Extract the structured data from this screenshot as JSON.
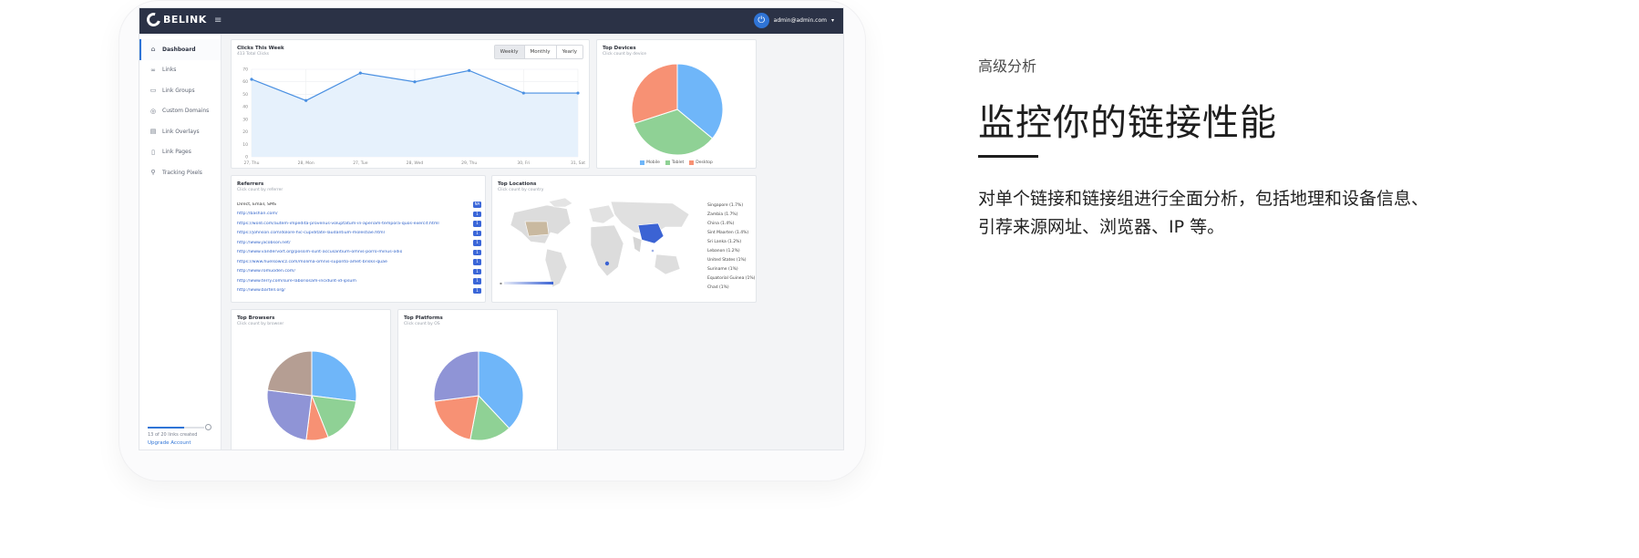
{
  "brand": {
    "logo_text": "BELINK",
    "menu_icon": "hamburger-icon"
  },
  "topbar": {
    "user_email": "admin@admin.com",
    "user_icon": "power-icon",
    "caret": "▾"
  },
  "sidebar": {
    "items": [
      {
        "label": "Dashboard",
        "icon": "home-icon",
        "active": true
      },
      {
        "label": "Links",
        "icon": "link-icon"
      },
      {
        "label": "Link Groups",
        "icon": "folder-icon"
      },
      {
        "label": "Custom Domains",
        "icon": "globe-icon"
      },
      {
        "label": "Link Overlays",
        "icon": "layers-icon"
      },
      {
        "label": "Link Pages",
        "icon": "page-icon"
      },
      {
        "label": "Tracking Pixels",
        "icon": "pin-icon"
      }
    ],
    "usage_text": "13 of 20 links created",
    "usage_fraction": 0.65,
    "upgrade_label": "Upgrade Account"
  },
  "clicks_card": {
    "title": "Clicks This Week",
    "subtitle": "413 Total Clicks",
    "range_buttons": [
      "Weekly",
      "Monthly",
      "Yearly"
    ],
    "selected_range": "Weekly",
    "chart_data": {
      "type": "area",
      "categories": [
        "27, Thu",
        "28, Mon",
        "27, Tue",
        "28, Wed",
        "29, Thu",
        "30, Fri",
        "31, Sat"
      ],
      "values": [
        62,
        45,
        67,
        60,
        69,
        51,
        51
      ],
      "ylim": [
        0,
        70
      ],
      "yticks": [
        0,
        10,
        20,
        30,
        40,
        50,
        60,
        70
      ],
      "line_color": "#4a90e2",
      "fill_color": "#e6f1fc"
    }
  },
  "devices_card": {
    "title": "Top Devices",
    "subtitle": "Click count by device",
    "chart_data": {
      "type": "pie",
      "labels": [
        "Mobile",
        "Tablet",
        "Desktop"
      ],
      "values": [
        36,
        34,
        30
      ],
      "colors": [
        "#6fb6f9",
        "#8fd195",
        "#f79174"
      ]
    }
  },
  "referrers_card": {
    "title": "Referrers",
    "subtitle": "Click count by referrer",
    "rows": [
      {
        "url": "Direct, Email, SMS",
        "count": "NA"
      },
      {
        "url": "http://bashan.com/",
        "count": "1"
      },
      {
        "url": "https://wold.com/autem-impedita-provenus-voluptatum-in-aperiam-tempora-quos-exercit.html",
        "count": "1"
      },
      {
        "url": "https://johnson.com/dolore-hic-cupiditate-laudantium-molestiae.html",
        "count": "1"
      },
      {
        "url": "http://www.jacobson.net/",
        "count": "1"
      },
      {
        "url": "http://www.vandervort.org/possim-sunt-accusantium-omnis-porro-minus-odio",
        "count": "1"
      },
      {
        "url": "https://www.huelsowicz.com/molima-omnis-suponto-amet-brisks-quae",
        "count": "1"
      },
      {
        "url": "http://www.romuoden.com/",
        "count": "1"
      },
      {
        "url": "http://www.terry.com/sure-laboriosam-incidunt-id-ipsum",
        "count": "1"
      },
      {
        "url": "http://www.bartell.org/",
        "count": "1"
      }
    ]
  },
  "locations_card": {
    "title": "Top Locations",
    "subtitle": "Click count by country",
    "countries": [
      "Singapore (1.7%)",
      "Zambia (1.7%)",
      "China (1.4%)",
      "Sint Maarten (1.4%)",
      "Sri Lanka (1.2%)",
      "Lebanon (1.2%)",
      "United States (1%)",
      "Suriname (1%)",
      "Equatorial Guinea (1%)",
      "Chad (1%)"
    ]
  },
  "browsers_card": {
    "title": "Top Browsers",
    "subtitle": "Click count by browser",
    "chart_data": {
      "type": "pie",
      "values": [
        27,
        17,
        8,
        25,
        23
      ],
      "colors": [
        "#6fb6f9",
        "#8fd195",
        "#f79174",
        "#8f94d6",
        "#b59e93"
      ]
    }
  },
  "platforms_card": {
    "title": "Top Platforms",
    "subtitle": "Click count by OS",
    "chart_data": {
      "type": "pie",
      "values": [
        38,
        15,
        20,
        27
      ],
      "colors": [
        "#6fb6f9",
        "#8fd195",
        "#f79174",
        "#8f94d6"
      ]
    }
  },
  "feature": {
    "eyebrow": "高级分析",
    "headline": "监控你的链接性能",
    "description": "对单个链接和链接组进行全面分析，包括地理和设备信息、引荐来源网址、浏览器、IP 等。"
  }
}
